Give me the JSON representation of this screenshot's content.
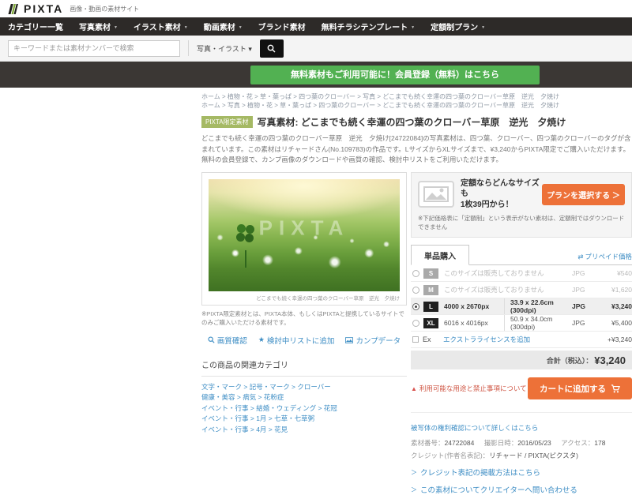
{
  "colors": {
    "accent_orange": "#ed7138",
    "brand_green": "#52b152",
    "link_blue": "#3d8dc4",
    "badge_olive": "#a5b964",
    "nav_dark": "#2d2a28"
  },
  "header": {
    "logo": "PIXTA",
    "tagline": "画像・動画の素材サイト",
    "nav": [
      {
        "label": "カテゴリー一覧"
      },
      {
        "label": "写真素材"
      },
      {
        "label": "イラスト素材"
      },
      {
        "label": "動画素材"
      },
      {
        "label": "ブランド素材"
      },
      {
        "label": "無料チラシテンプレート"
      },
      {
        "label": "定額制プラン"
      }
    ],
    "search": {
      "placeholder": "キーワードまたは素材ナンバーで検索",
      "category": "写真・イラスト ▾"
    },
    "banner": "無料素材もご利用可能に！会員登録（無料）はこちら"
  },
  "breadcrumbs": [
    "ホーム > 植物・花 > 草・葉っぱ > 四つ葉のクローバー > 写真 > どこまでも続く幸運の四つ葉のクローバー草原　逆光　夕焼け",
    "ホーム > 写真 > 植物・花 > 草・葉っぱ > 四つ葉のクローバー > どこまでも続く幸運の四つ葉のクローバー草原　逆光　夕焼け"
  ],
  "product": {
    "badge": "PIXTA限定素材",
    "title": "写真素材: どこまでも続く幸運の四つ葉のクローバー草原　逆光　夕焼け",
    "description": "どこまでも続く幸運の四つ葉のクローバー草原　逆光　夕焼け[24722084]の写真素材は、四つ葉、クローバー、四つ葉のクローバーのタグが含まれています。この素材はリチャードさん(No.109783)の作品です。LサイズからXLサイズまで、¥3,240からPIXTA限定でご購入いただけます。無料の会員登録で、カンプ画像のダウンロードや画質の確認、検討中リストをご利用いただけます。",
    "watermark": "PIXTA",
    "image_caption": "どこまでも続く幸運の四つ葉のクローバー草原　逆光　夕焼け",
    "exclusive_note": "※PIXTA限定素材とは、PIXTA本体、もしくはPIXTAと提携しているサイトでのみご購入いただける素材です。",
    "actions": {
      "quality": "画質確認",
      "shortlist": "検討中リストに追加",
      "comp": "カンプデータ"
    }
  },
  "related": {
    "heading": "この商品の関連カテゴリ",
    "links": [
      "文字・マーク > 記号・マーク > クローバー",
      "健康・美容 > 病気 > 花粉症",
      "イベント・行事 > 結婚・ウェディング > 花冠",
      "イベント・行事 > 1月 > 七草・七草粥",
      "イベント・行事 > 4月 > 花見"
    ]
  },
  "subscription": {
    "text_line1": "定額ならどんなサイズも",
    "text_line2": "1枚39円から！",
    "button": "プランを選択する ＞",
    "note": "※下記価格表に「定額制」という表示がない素材は、定額制ではダウンロードできません"
  },
  "pricing": {
    "tab": "単品購入",
    "prepaid_link": "プリペイド価格",
    "rows": [
      {
        "size": "S",
        "note": "このサイズは販売しておりません",
        "format": "JPG",
        "price": "¥540"
      },
      {
        "size": "M",
        "note": "このサイズは販売しておりません",
        "format": "JPG",
        "price": "¥1,620"
      },
      {
        "size": "L",
        "px": "4000 x 2670px",
        "cm": "33.9 x 22.6cm (300dpi)",
        "format": "JPG",
        "price": "¥3,240"
      },
      {
        "size": "XL",
        "px": "6016 x 4016px",
        "cm": "50.9 x 34.0cm (300dpi)",
        "format": "JPG",
        "price": "¥5,400"
      },
      {
        "size": "Ex",
        "link": "エクストラライセンスを追加",
        "price": "+¥3,240"
      }
    ],
    "total_label": "合計（税込）：",
    "total_value": "¥3,240",
    "warning": "利用可能な用途と禁止事項について",
    "cart_button": "カートに追加する"
  },
  "details": {
    "rights_link": "被写体の権利確認について詳しくはこちら",
    "fields": [
      {
        "label": "素材番号：",
        "value": "24722084"
      },
      {
        "label": "撮影日時：",
        "value": "2016/05/23"
      },
      {
        "label": "アクセス：",
        "value": "178"
      }
    ],
    "credit_label": "クレジット(作者名表記)：",
    "credit_value": "リチャード / PIXTA(ピクスタ)",
    "links": [
      "クレジット表記の掲載方法はこちら",
      "この素材についてクリエイターへ問い合わせる"
    ]
  }
}
